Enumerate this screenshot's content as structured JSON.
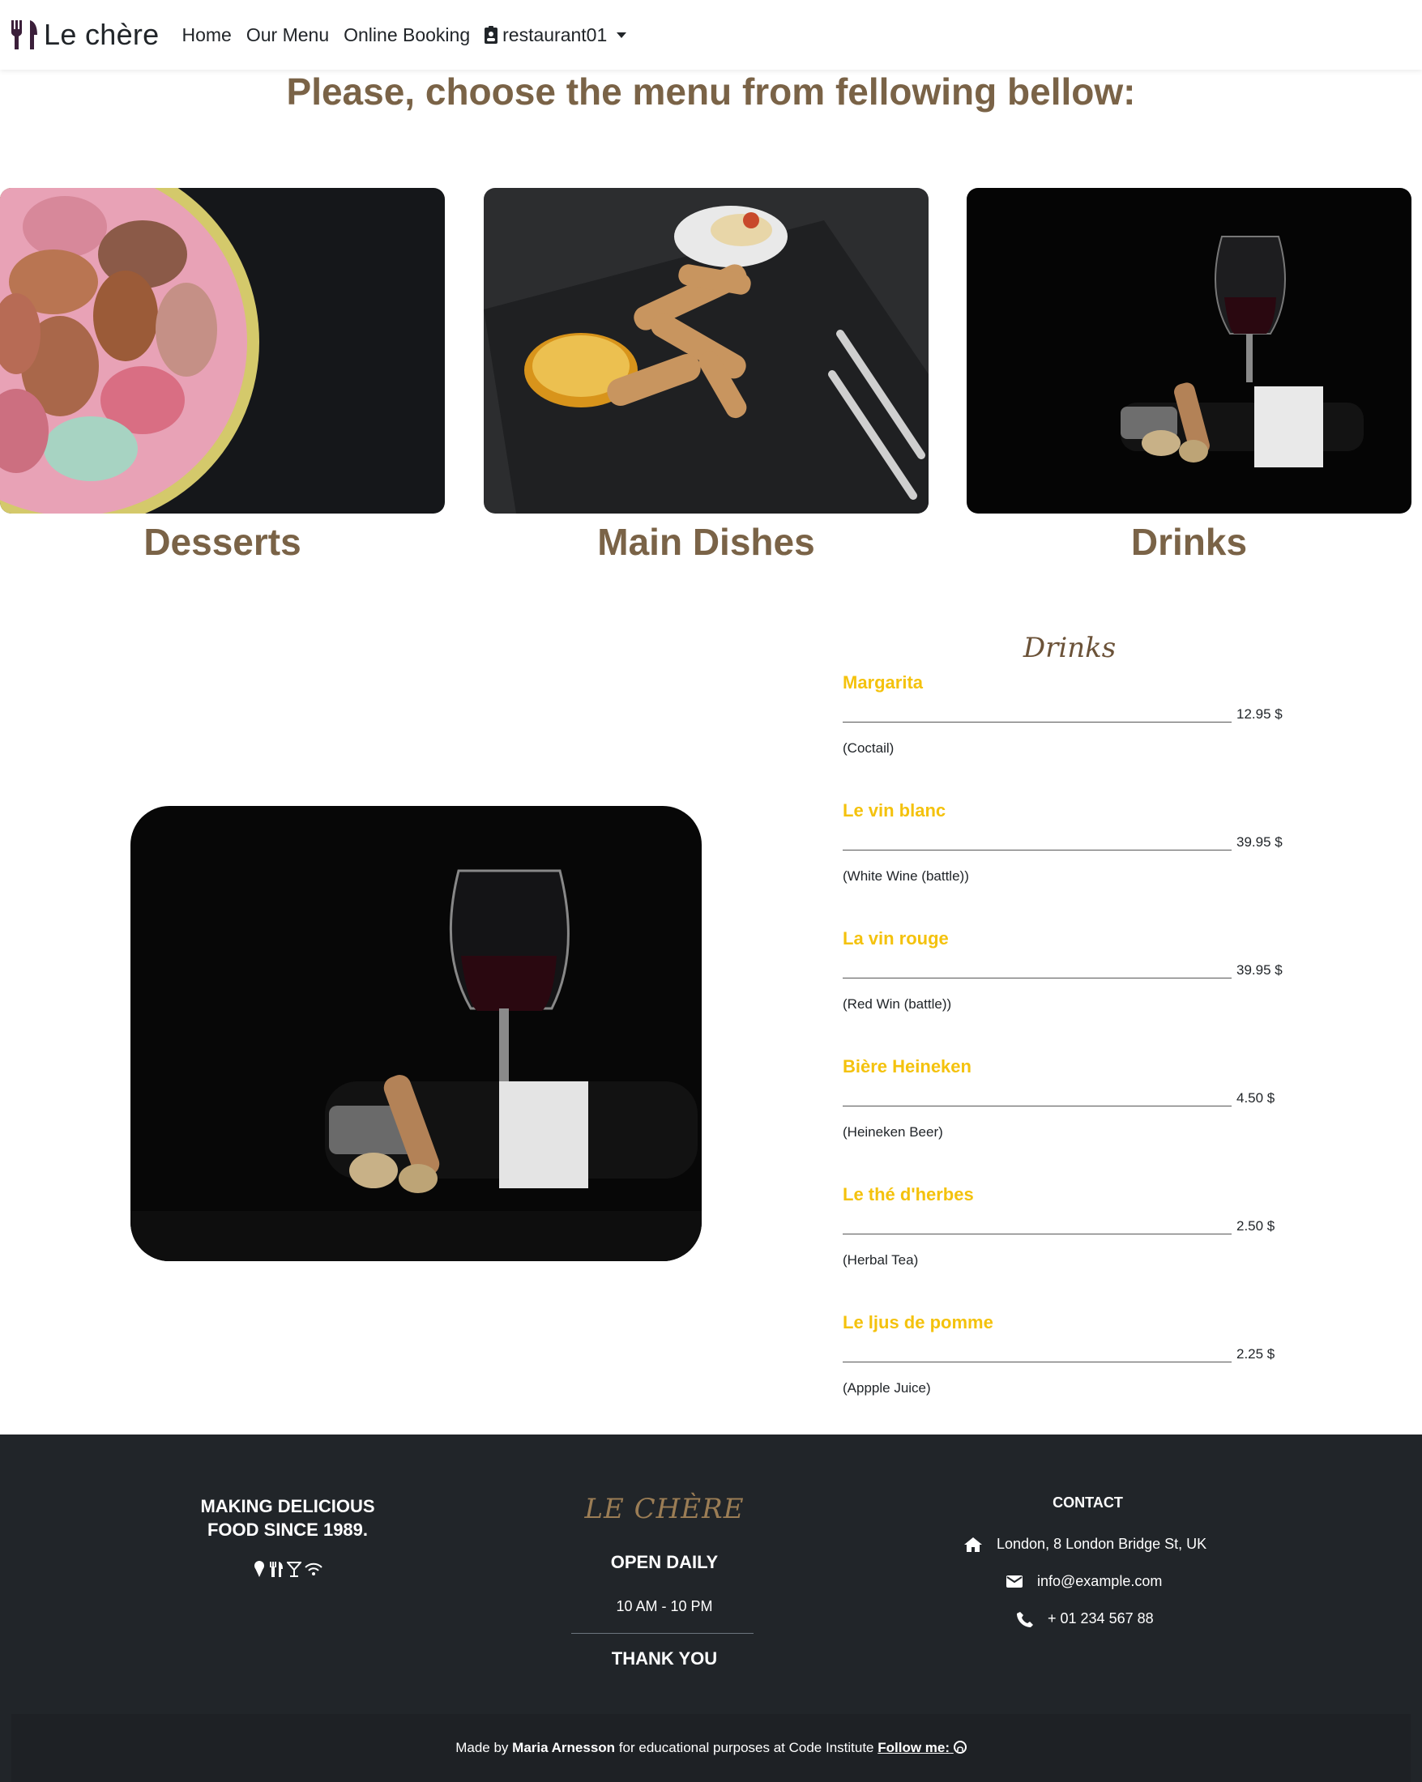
{
  "nav": {
    "brand": "Le chère",
    "links": [
      "Home",
      "Our Menu",
      "Online Booking"
    ],
    "user": "restaurant01"
  },
  "page_heading": "Please, choose the menu from fellowing bellow:",
  "categories": [
    {
      "title": "Desserts",
      "image": "macarons-bowl"
    },
    {
      "title": "Main Dishes",
      "image": "fried-dish-slate"
    },
    {
      "title": "Drinks",
      "image": "wine-glass-bottle"
    }
  ],
  "menu": {
    "title": "Drinks",
    "image": "wine-glass-bottle",
    "items": [
      {
        "name": "Margarita",
        "price": "12.95 $",
        "desc": "(Coctail)"
      },
      {
        "name": "Le vin blanc",
        "price": "39.95 $",
        "desc": "(White Wine (battle))"
      },
      {
        "name": "La vin rouge",
        "price": "39.95 $",
        "desc": "(Red Win (battle))"
      },
      {
        "name": "Bière Heineken",
        "price": "4.50 $",
        "desc": "(Heineken Beer)"
      },
      {
        "name": "Le thé d'herbes",
        "price": "2.50 $",
        "desc": "(Herbal Tea)"
      },
      {
        "name": "Le ljus de pomme",
        "price": "2.25 $",
        "desc": "(Appple Juice)"
      }
    ]
  },
  "footer": {
    "tagline_1": "MAKING DELICIOUS",
    "tagline_2": "FOOD SINCE 1989.",
    "icons": [
      "ice-cream-icon",
      "utensils-icon",
      "cocktail-icon",
      "wifi-icon"
    ],
    "logo": "LE CHÈRE",
    "open_label": "OPEN DAILY",
    "hours": "10 AM - 10 PM",
    "thanks": "THANK YOU",
    "contact_head": "CONTACT",
    "address": "London, 8 London Bridge St, UK",
    "email": "info@example.com",
    "phone": "+ 01 234 567 88",
    "credit_pre": "Made by",
    "credit_name": "Maria Arnesson",
    "credit_post": "for educational purposes at Code Institute",
    "follow": "Follow me:"
  },
  "colors": {
    "heading": "#7a6347",
    "item_name": "#f4c20d",
    "footer_bg": "#212529",
    "footer_logo": "#9b7d55"
  }
}
